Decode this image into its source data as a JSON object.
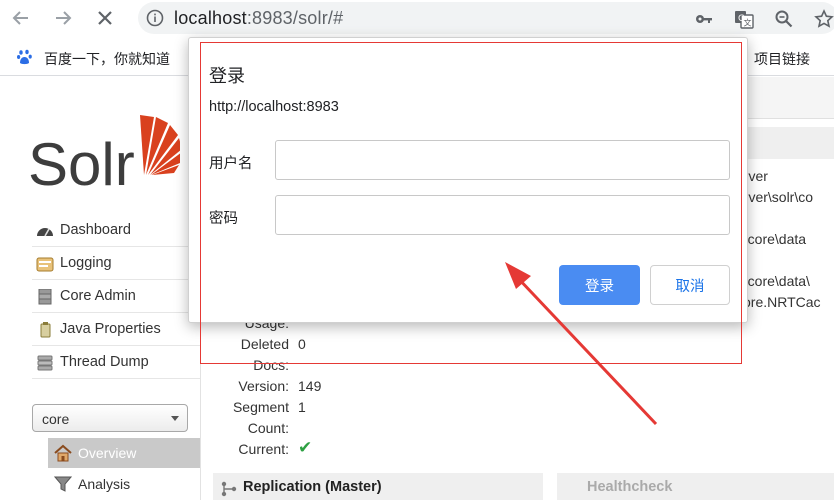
{
  "browser": {
    "url_host": "localhost",
    "url_rest": ":8983/solr/#",
    "icons": [
      "back-icon",
      "forward-icon",
      "stop-icon",
      "info-icon",
      "key-icon",
      "translate-icon",
      "zoom-icon",
      "star-icon"
    ]
  },
  "bookmarks": {
    "left_label": "百度一下，你就知道",
    "right_label": "项目链接"
  },
  "sidebar": {
    "logo_text": "Solr",
    "items": [
      {
        "label": "Dashboard"
      },
      {
        "label": "Logging"
      },
      {
        "label": "Core Admin"
      },
      {
        "label": "Java Properties"
      },
      {
        "label": "Thread Dump"
      }
    ],
    "core_select": "core",
    "sub_items": [
      {
        "label": "Overview"
      },
      {
        "label": "Analysis"
      }
    ]
  },
  "content": {
    "right_fragments": [
      "erver",
      "erver\\solr\\co",
      "lr\\core\\data",
      "lr\\core\\data\\",
      "core.NRTCac"
    ],
    "stats": [
      {
        "label": "Usage:",
        "value": ""
      },
      {
        "label": "Deleted",
        "value": "0"
      },
      {
        "label": "Docs:",
        "value": ""
      },
      {
        "label": "Version:",
        "value": "149"
      },
      {
        "label": "Segment",
        "value": "1"
      },
      {
        "label": "Count:",
        "value": ""
      },
      {
        "label": "Current:",
        "value": "✔"
      }
    ],
    "replication_label": "Replication (Master)",
    "healthcheck_label": "Healthcheck"
  },
  "dialog": {
    "title": "登录",
    "url": "http://localhost:8983",
    "username_label": "用户名",
    "password_label": "密码",
    "username_value": "",
    "password_value": "",
    "login_button": "登录",
    "cancel_button": "取消"
  },
  "colors": {
    "accent": "#4a8cf2",
    "solr_red": "#d9411e",
    "annotation": "#e53935",
    "check_green": "#2ea043"
  }
}
